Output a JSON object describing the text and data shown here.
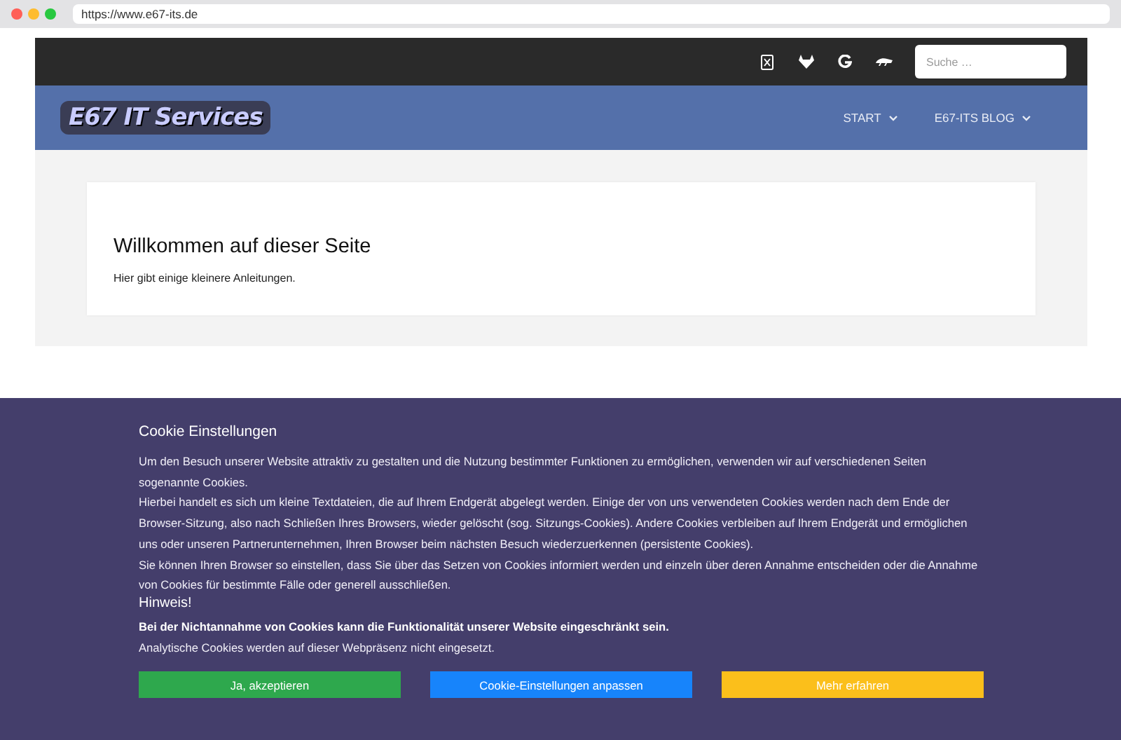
{
  "browser": {
    "url": "https://www.e67-its.de"
  },
  "topbar": {
    "icons": [
      {
        "kind": "xing"
      },
      {
        "kind": "gitlab"
      },
      {
        "kind": "google"
      },
      {
        "kind": "chameleon"
      }
    ],
    "search": {
      "placeholder": "Suche …"
    }
  },
  "nav": {
    "logo": "E67 IT Services",
    "items": [
      {
        "label": "START",
        "selected": false
      },
      {
        "label": "E67-ITS BLOG",
        "selected": false
      }
    ]
  },
  "welcome": {
    "title": "Willkommen auf dieser Seite",
    "text": "Hier gibt einige kleinere Anleitungen."
  },
  "cookie_banner": {
    "title": "Cookie Einstellungen",
    "paragraphs": [
      "Um den Besuch unserer Website attraktiv zu gestalten und die Nutzung bestimmter Funktionen zu ermöglichen, verwenden wir auf verschiedenen Seiten sogenannte Cookies.",
      "Hierbei handelt es sich um kleine Textdateien, die auf Ihrem Endgerät abgelegt werden. Einige der von uns verwendeten Cookies werden nach dem Ende der Browser-Sitzung, also nach Schließen Ihres Browsers, wieder gelöscht (sog. Sitzungs-Cookies). Andere Cookies verbleiben auf Ihrem Endgerät und ermöglichen uns oder unseren Partnerunternehmen, Ihren Browser beim nächsten Besuch wiederzuerkennen (persistente Cookies).",
      "Sie können Ihren Browser so einstellen, dass Sie über das Setzen von Cookies informiert werden und einzeln über deren Annahme entscheiden oder die Annahme von Cookies für bestimmte Fälle oder generell ausschließen."
    ],
    "notice_title": "Hinweis!",
    "notice_bold": "Bei der Nichtannahme von Cookies kann die Funktionalität unserer Website eingeschränkt sein.",
    "notice_text": "Analytische Cookies werden auf dieser Webpräsenz nicht eingesetzt.",
    "buttons": [
      {
        "label": "Ja, akzeptieren",
        "color": "#2ea84d"
      },
      {
        "label": "Cookie-Einstellungen anpassen",
        "color": "#1784fb"
      },
      {
        "label": "Mehr erfahren",
        "color": "#fbbf1b"
      }
    ]
  }
}
